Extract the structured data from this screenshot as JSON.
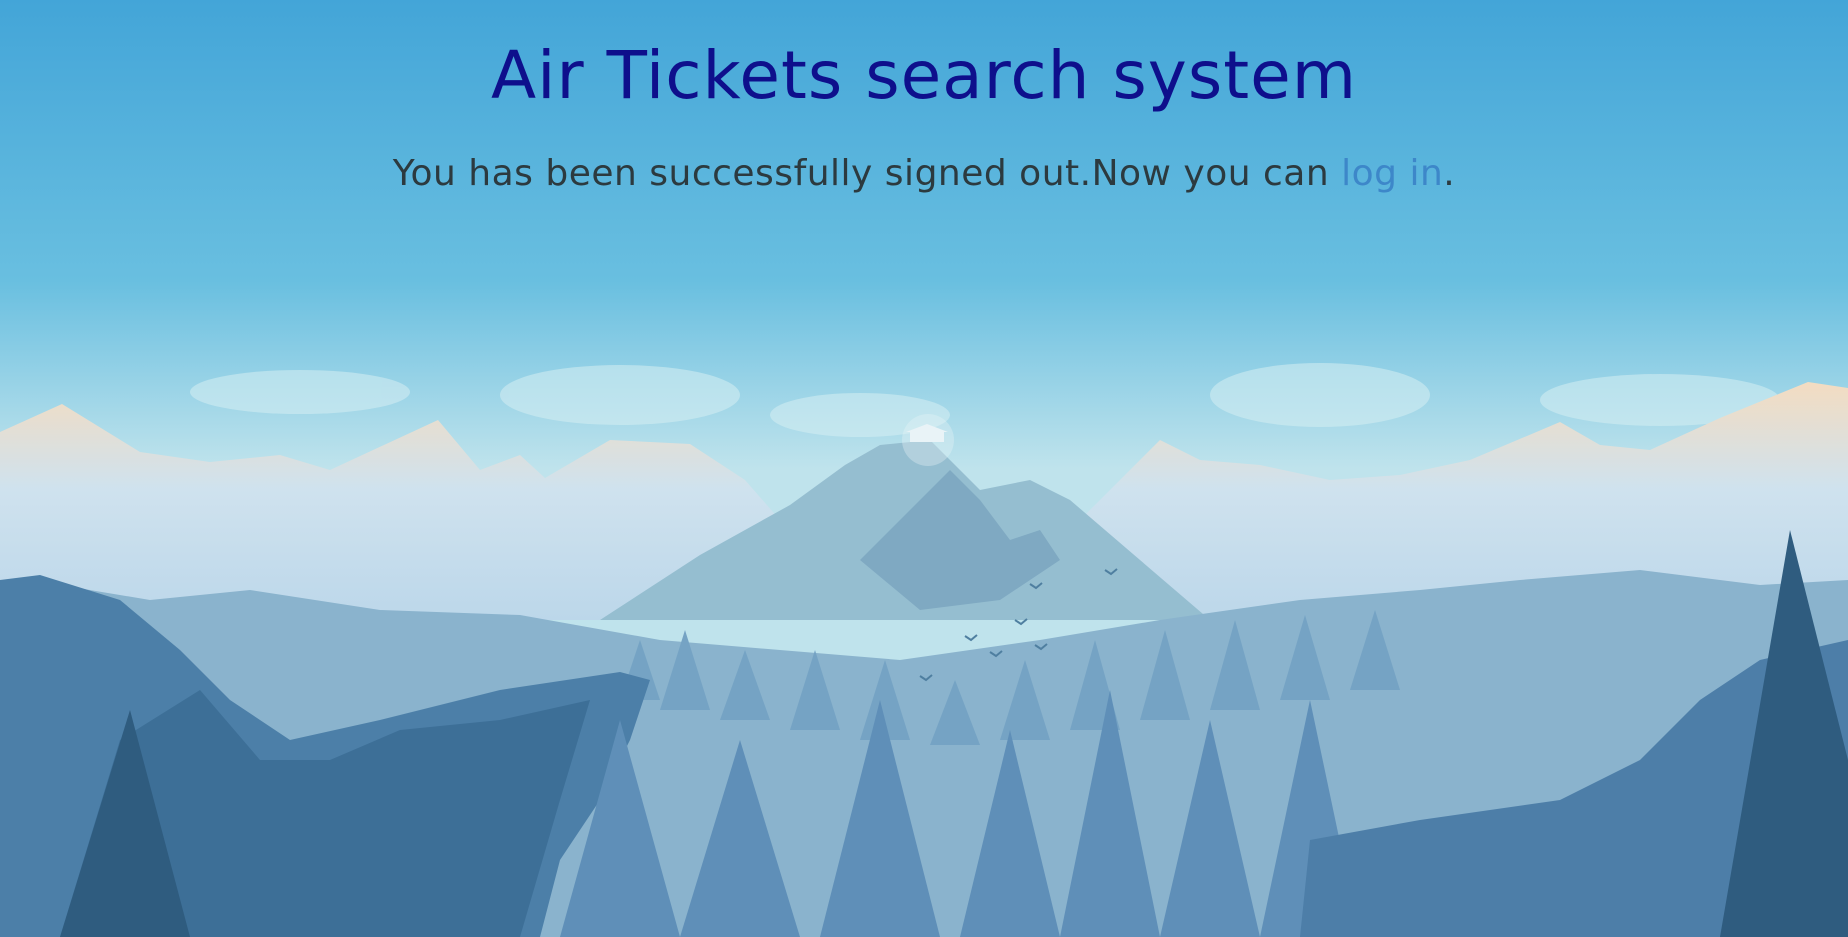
{
  "header": {
    "title": "Air Tickets search system"
  },
  "signout_message": {
    "text": "You has been successfully signed out.Now you can ",
    "link_label": "log in",
    "suffix": "."
  },
  "colors": {
    "title": "#0e0f8c",
    "body_text": "#2c3a3f",
    "link": "#3d87c9",
    "sky_top": "#44a6d6"
  }
}
